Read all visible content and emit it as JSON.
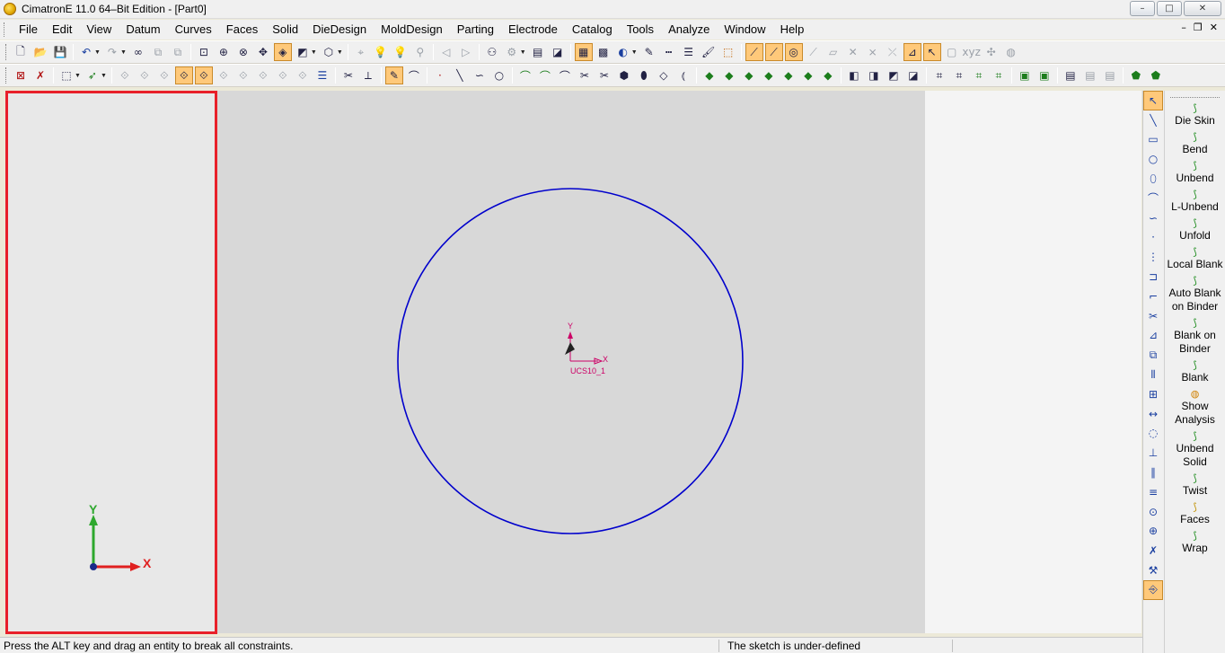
{
  "window": {
    "title": "CimatronE 11.0 64–Bit Edition - [Part0]",
    "controls": {
      "minimize": "–",
      "maximize": "□",
      "close": "✕"
    }
  },
  "menubar": {
    "items": [
      "File",
      "Edit",
      "View",
      "Datum",
      "Curves",
      "Faces",
      "Solid",
      "DieDesign",
      "MoldDesign",
      "Parting",
      "Electrode",
      "Catalog",
      "Tools",
      "Analyze",
      "Window",
      "Help"
    ],
    "mdi": {
      "minimize": "–",
      "restore": "❐",
      "close": "✕"
    }
  },
  "viewport": {
    "circle_color": "#0000cc",
    "ucs_label": "UCS10_1",
    "ucs_x": "X",
    "ucs_y": "Y",
    "ucs_color": "#cc0066"
  },
  "triad": {
    "x_label": "X",
    "y_label": "Y"
  },
  "statusbar": {
    "hint": "Press the ALT key and drag an entity to break all constraints.",
    "sketch_state": "The sketch is under-defined"
  },
  "die_panel": {
    "items": [
      {
        "label": "Die Skin",
        "icon": "die-skin-icon"
      },
      {
        "label": "Bend",
        "icon": "bend-icon"
      },
      {
        "label": "Unbend",
        "icon": "unbend-icon"
      },
      {
        "label": "L-Unbend",
        "icon": "l-unbend-icon"
      },
      {
        "label": "Unfold",
        "icon": "unfold-icon"
      },
      {
        "label": "Local Blank",
        "icon": "local-blank-icon"
      },
      {
        "label": "Auto Blank on Binder",
        "icon": "auto-blank-icon"
      },
      {
        "label": "Blank on Binder",
        "icon": "blank-on-binder-icon"
      },
      {
        "label": "Blank",
        "icon": "blank-icon"
      },
      {
        "label": "Show Analysis",
        "icon": "show-analysis-icon"
      },
      {
        "label": "Unbend Solid",
        "icon": "unbend-solid-icon"
      },
      {
        "label": "Twist",
        "icon": "twist-icon"
      },
      {
        "label": "Faces",
        "icon": "faces-icon"
      },
      {
        "label": "Wrap",
        "icon": "wrap-icon"
      }
    ]
  },
  "colors": {
    "highlight": "#ffc97a",
    "panel_border": "#e8202a",
    "viewport_bg": "#d8d8d8"
  }
}
